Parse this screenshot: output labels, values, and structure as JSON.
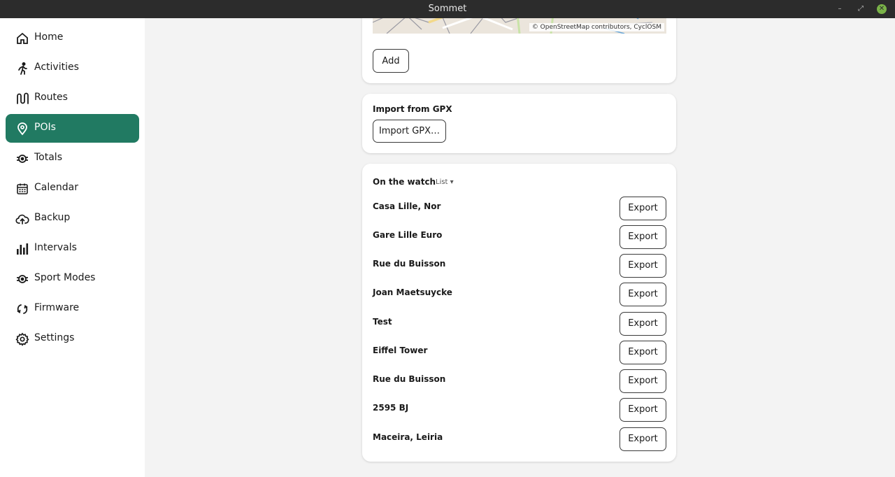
{
  "window": {
    "title": "Sommet",
    "controls": {
      "minimize": "–",
      "maximize": "⤢",
      "close": "✕"
    }
  },
  "sidebar": {
    "items": [
      {
        "label": "Home",
        "icon": "home-icon",
        "active": false
      },
      {
        "label": "Activities",
        "icon": "runner-icon",
        "active": false
      },
      {
        "label": "Routes",
        "icon": "route-icon",
        "active": false
      },
      {
        "label": "POIs",
        "icon": "map-pin-icon",
        "active": true
      },
      {
        "label": "Totals",
        "icon": "watch-icon",
        "active": false
      },
      {
        "label": "Calendar",
        "icon": "calendar-icon",
        "active": false
      },
      {
        "label": "Backup",
        "icon": "cloud-upload-icon",
        "active": false
      },
      {
        "label": "Intervals",
        "icon": "bars-icon",
        "active": false
      },
      {
        "label": "Sport Modes",
        "icon": "watch-icon",
        "active": false
      },
      {
        "label": "Firmware",
        "icon": "refresh-icon",
        "active": false
      },
      {
        "label": "Settings",
        "icon": "gear-icon",
        "active": false
      }
    ]
  },
  "add_card": {
    "map_attribution": "© OpenStreetMap contributors, CyclOSM",
    "add_button": "Add"
  },
  "import_card": {
    "title": "Import from GPX",
    "button": "Import GPX…"
  },
  "watch_card": {
    "title": "On the watch",
    "view_select": "List ▾",
    "export_label": "Export",
    "pois": [
      "Casa Lille, Nor",
      "Gare Lille Euro",
      "Rue du Buisson",
      "Joan Maetsuycke",
      "Test",
      "Eiffel Tower",
      "Rue du Buisson",
      "2595 BJ",
      "Maceira, Leiria"
    ]
  },
  "colors": {
    "accent": "#217a62",
    "titlebar": "#2c2c2c",
    "background": "#f3f3f3"
  }
}
